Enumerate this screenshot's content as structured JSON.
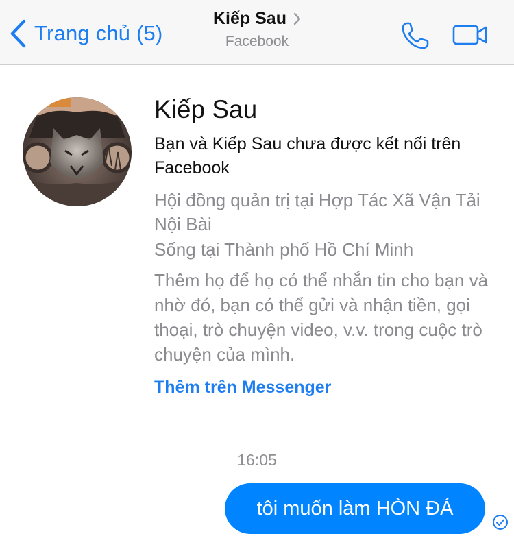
{
  "nav": {
    "back_label": "Trang chủ (5)",
    "title": "Kiếp Sau",
    "subtitle": "Facebook",
    "accent": "#1e7ef0"
  },
  "profile": {
    "name": "Kiếp Sau",
    "connection_status": "Bạn và Kiếp Sau chưa được kết nối trên Facebook",
    "work": "Hội đồng quản trị tại Hợp Tác Xã Vận Tải Nội Bài",
    "lives": "Sống tại Thành phố Hồ Chí Minh",
    "description": "Thêm họ để họ có thể nhắn tin cho bạn và nhờ đó, bạn có thể gửi và nhận tiền, gọi thoại, trò chuyện video, v.v. trong cuộc trò chuyện của mình.",
    "add_link": "Thêm trên Messenger"
  },
  "chat": {
    "timestamp": "16:05",
    "messages": [
      {
        "text": "tôi muốn làm HÒN ĐÁ",
        "sender": "me",
        "status": "sent"
      }
    ],
    "bubble_color": "#0084ff"
  },
  "icons": {
    "back": "chevron-left-icon",
    "title_arrow": "chevron-right-icon",
    "call": "phone-icon",
    "video": "video-camera-icon",
    "receipt": "sent-check-icon"
  }
}
